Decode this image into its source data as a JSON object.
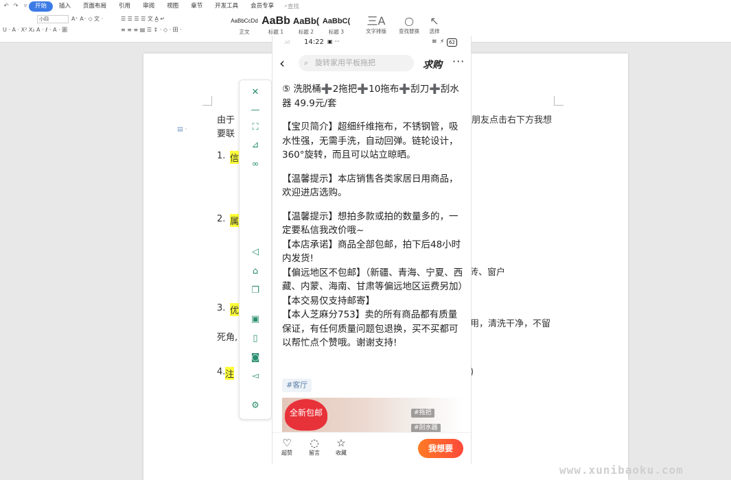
{
  "ribbon": {
    "menu_tabs": [
      "开始",
      "插入",
      "页面布局",
      "引用",
      "审阅",
      "视图",
      "章节",
      "开发工具",
      "会员专享"
    ],
    "search": "查找",
    "font_size": "小四",
    "row1_tools": "A⁺ A⁻ ◇ 文 ·",
    "row1_tools2": "☰ ☰ ☰ ☰ 文 A̲ ↵",
    "row2_tools": "U · A · X² X₂ A · ℓ · A · 圖",
    "row2_tools2": "≡ ≡ ≡ ▤ ☰ ↕ · ◇ · 田 ·",
    "styles": [
      {
        "preview": "AaBbCcDd",
        "caption": "正文"
      },
      {
        "preview": "AaBb",
        "caption": "标题 1"
      },
      {
        "preview": "AaBb(",
        "caption": "标题 2"
      },
      {
        "preview": "AaBbC(",
        "caption": "标题 3"
      }
    ],
    "big_tools": [
      {
        "glyph": "三A",
        "label": "文字排版"
      },
      {
        "glyph": "○",
        "label": "查找替换"
      },
      {
        "glyph": "↖",
        "label": "选择"
      }
    ]
  },
  "document": {
    "line1_left": "由于",
    "line1_right": "朋友点击右下方我想",
    "line2": "要联",
    "item1_num": "1.",
    "item1_text": "信",
    "item2_num": "2.",
    "item2_text": "属",
    "item2_right": "砖、窗户",
    "item3_num": "3.",
    "item3_text": "优",
    "item3_right": "用，清洗干净，不留",
    "item3_line2": "死角,",
    "item4_num": "4.",
    "item4_text": "注",
    "item4_right": ")"
  },
  "side_toolbar": {
    "icons": [
      "close-icon",
      "minimize-icon",
      "fullscreen-icon",
      "pin-icon",
      "link-icon",
      "back-icon",
      "home-icon",
      "multiwindow-icon",
      "image-icon",
      "document-icon",
      "camera-icon",
      "volume-icon",
      "settings-icon"
    ]
  },
  "phone": {
    "status_time": "14:22",
    "status_extra": "▣ ···",
    "status_right": "62",
    "search_placeholder": "旋转家用平板拖把",
    "qiugou": "求购",
    "content": [
      "⑤ 洗脱桶➕2拖把➕10拖布➕刮刀➕刮水器       49.9元/套",
      "【宝贝简介】超细纤维拖布，不锈钢管，吸水性强，无需手洗，自动回弹。链轮设计，360°旋转，而且可以站立晾晒。",
      "【温馨提示】本店销售各类家居日用商品，欢迎进店选购。",
      "【温馨提示】想拍多款或拍的数量多的，一定要私信我改价哦~",
      "【本店承诺】商品全部包邮，拍下后48小时内发货!",
      "【偏远地区不包邮】（新疆、青海、宁夏、西藏、内蒙、海南、甘肃等偏远地区运费另加）",
      "【本交易仅支持邮寄】",
      "【本人芝麻分753】卖的所有商品都有质量保证，有任何质量问题包退换，买不买都可以帮忙点个赞哦。谢谢支持!"
    ],
    "tag": "#客厅",
    "image_badge": "全新包邮",
    "image_tags": [
      "#拖把",
      "#刮水器"
    ],
    "bottom": {
      "like": "超赞",
      "comment": "留言",
      "favorite": "收藏",
      "want": "我想要"
    }
  },
  "watermark": "www.xunibaoku.com"
}
